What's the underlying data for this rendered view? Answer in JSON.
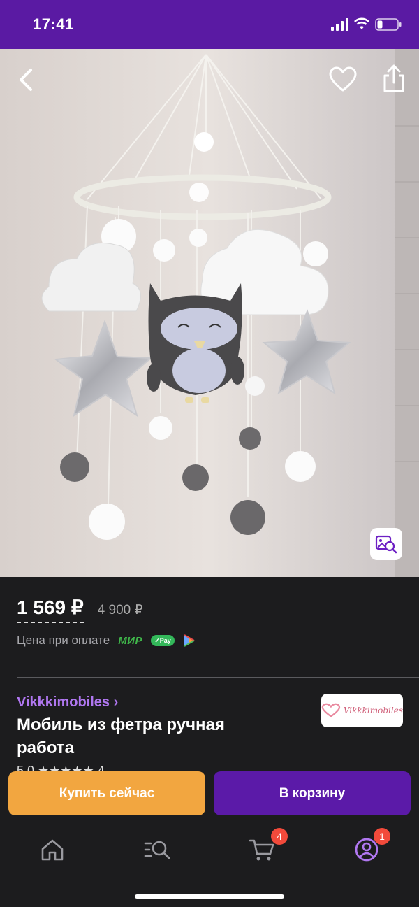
{
  "status_bar": {
    "time": "17:41"
  },
  "product": {
    "price": "1 569 ₽",
    "old_price": "4 900 ₽",
    "payment_label": "Цена при оплате",
    "payment_methods": [
      "МИР",
      "SberPay",
      "СБП"
    ],
    "mir_label": "МИР",
    "sberpay_label": "Pay",
    "seller": "Vikkkimobiles ›",
    "title": "Мобиль из фетра ручная работа",
    "brand_logo_text": "Vikkkimobiles",
    "rating_partial": "5.0 ★★★★★ 4"
  },
  "actions": {
    "buy_now": "Купить сейчас",
    "add_to_cart": "В корзину"
  },
  "tabbar": {
    "items": [
      {
        "name": "home",
        "icon": "home-icon"
      },
      {
        "name": "catalog",
        "icon": "catalog-search-icon"
      },
      {
        "name": "cart",
        "icon": "cart-icon",
        "badge": "4"
      },
      {
        "name": "profile",
        "icon": "profile-icon",
        "badge": "1"
      }
    ]
  },
  "colors": {
    "status_bar": "#5a1aa3",
    "accent_purple": "#5b1aa8",
    "seller_link": "#b077f0",
    "buy_orange": "#f2a640",
    "badge_red": "#f24a3b",
    "background": "#1c1c1e"
  }
}
